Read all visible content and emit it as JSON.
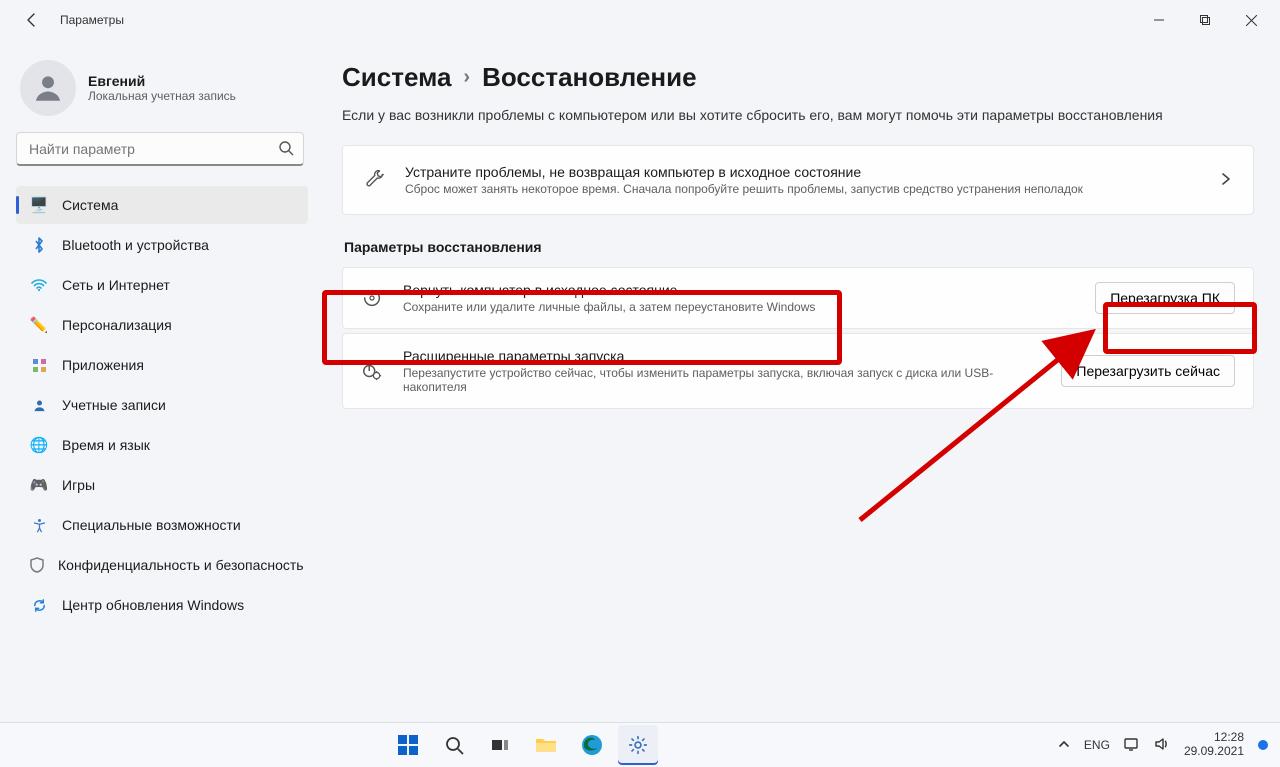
{
  "titlebar": {
    "title": "Параметры"
  },
  "user": {
    "name": "Евгений",
    "sub": "Локальная учетная запись"
  },
  "search": {
    "placeholder": "Найти параметр"
  },
  "nav": {
    "items": [
      {
        "label": "Система"
      },
      {
        "label": "Bluetooth и устройства"
      },
      {
        "label": "Сеть и Интернет"
      },
      {
        "label": "Персонализация"
      },
      {
        "label": "Приложения"
      },
      {
        "label": "Учетные записи"
      },
      {
        "label": "Время и язык"
      },
      {
        "label": "Игры"
      },
      {
        "label": "Специальные возможности"
      },
      {
        "label": "Конфиденциальность и безопасность"
      },
      {
        "label": "Центр обновления Windows"
      }
    ]
  },
  "breadcrumbs": {
    "parent": "Система",
    "current": "Восстановление"
  },
  "subtitle": "Если у вас возникли проблемы с компьютером или вы хотите сбросить его, вам могут помочь эти параметры восстановления",
  "troubleshoot": {
    "title": "Устраните проблемы, не возвращая компьютер в исходное состояние",
    "desc": "Сброс может занять некоторое время. Сначала попробуйте решить проблемы, запустив средство устранения неполадок"
  },
  "section_head": "Параметры восстановления",
  "reset": {
    "title": "Вернуть компьютер в исходное состояние",
    "desc": "Сохраните или удалите личные файлы, а затем переустановите Windows",
    "button": "Перезагрузка ПК"
  },
  "advanced": {
    "title": "Расширенные параметры запуска",
    "desc": "Перезапустите устройство сейчас, чтобы изменить параметры запуска, включая запуск с диска или USB-накопителя",
    "button": "Перезагрузить сейчас"
  },
  "tray": {
    "lang": "ENG",
    "time": "12:28",
    "date": "29.09.2021"
  }
}
